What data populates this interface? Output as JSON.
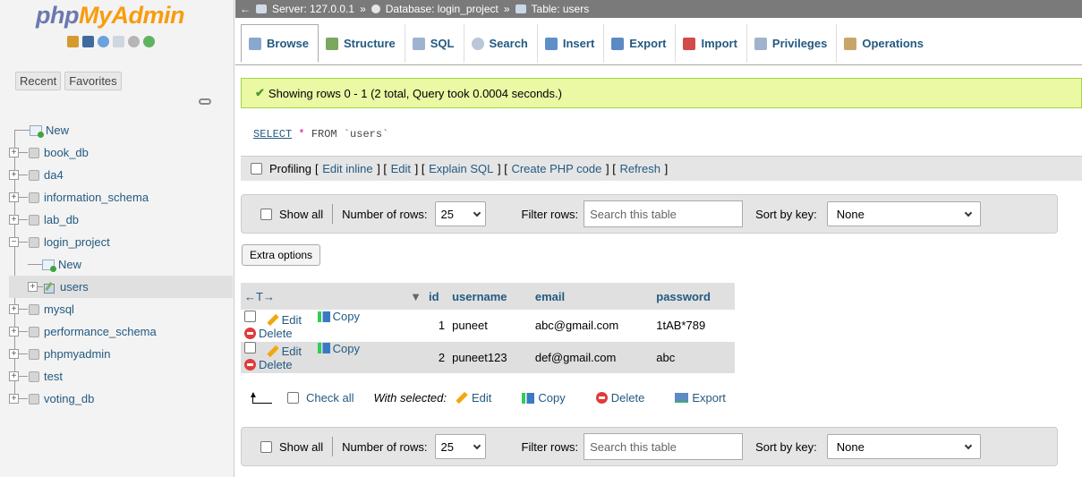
{
  "sidebar": {
    "logo_a": "php",
    "logo_b": "MyAdmin",
    "tabs": [
      "Recent",
      "Favorites"
    ],
    "tree": [
      {
        "label": "New",
        "kind": "new",
        "level": 0
      },
      {
        "label": "book_db",
        "kind": "db",
        "level": 0
      },
      {
        "label": "da4",
        "kind": "db",
        "level": 0
      },
      {
        "label": "information_schema",
        "kind": "db",
        "level": 0
      },
      {
        "label": "lab_db",
        "kind": "db",
        "level": 0
      },
      {
        "label": "login_project",
        "kind": "db-open",
        "level": 0
      },
      {
        "label": "New",
        "kind": "new",
        "level": 1
      },
      {
        "label": "users",
        "kind": "table",
        "level": 1
      },
      {
        "label": "mysql",
        "kind": "db",
        "level": 0
      },
      {
        "label": "performance_schema",
        "kind": "db",
        "level": 0
      },
      {
        "label": "phpmyadmin",
        "kind": "db",
        "level": 0
      },
      {
        "label": "test",
        "kind": "db",
        "level": 0
      },
      {
        "label": "voting_db",
        "kind": "db",
        "level": 0
      }
    ]
  },
  "breadcrumb": {
    "server": "Server: 127.0.0.1",
    "database": "Database: login_project",
    "table": "Table: users",
    "sep": "»"
  },
  "tabs": [
    {
      "label": "Browse",
      "icon": "browse-icon",
      "color": "#8aa8cf"
    },
    {
      "label": "Structure",
      "icon": "structure-icon",
      "color": "#79a85e"
    },
    {
      "label": "SQL",
      "icon": "sql-icon",
      "color": "#9db3cf"
    },
    {
      "label": "Search",
      "icon": "search-icon",
      "color": "#b9c7d8"
    },
    {
      "label": "Insert",
      "icon": "insert-icon",
      "color": "#5f8fc9"
    },
    {
      "label": "Export",
      "icon": "export-icon",
      "color": "#5d89c4"
    },
    {
      "label": "Import",
      "icon": "import-icon",
      "color": "#d24a4a"
    },
    {
      "label": "Privileges",
      "icon": "privileges-icon",
      "color": "#9fb3cc"
    },
    {
      "label": "Operations",
      "icon": "operations-icon",
      "color": "#c9a56a"
    }
  ],
  "success": {
    "text_a": "Showing rows 0 - 1 (2 total, Query took 0.0004 seconds.)"
  },
  "sql": {
    "kw": "SELECT",
    "op": "*",
    "rest": "FROM `users`"
  },
  "profiling": {
    "label": "Profiling",
    "links": [
      "Edit inline",
      "Edit",
      "Explain SQL",
      "Create PHP code",
      "Refresh"
    ]
  },
  "nav": {
    "show_all": "Show all",
    "rows_label": "Number of rows:",
    "rows_value": "25",
    "filter_label": "Filter rows:",
    "filter_placeholder": "Search this table",
    "sort_label": "Sort by key:",
    "sort_value": "None"
  },
  "extra_options": "Extra options",
  "table": {
    "nav_arrows": "←T→",
    "sort_arrow": "▼",
    "columns": [
      "id",
      "username",
      "email",
      "password"
    ],
    "actions": {
      "edit": "Edit",
      "copy": "Copy",
      "delete": "Delete"
    },
    "rows": [
      {
        "id": "1",
        "username": "puneet",
        "email": "abc@gmail.com",
        "password": "1tAB*789"
      },
      {
        "id": "2",
        "username": "puneet123",
        "email": "def@gmail.com",
        "password": "abc"
      }
    ]
  },
  "bulk": {
    "check_all": "Check all",
    "with_selected": "With selected:",
    "edit": "Edit",
    "copy": "Copy",
    "delete": "Delete",
    "export": "Export"
  }
}
